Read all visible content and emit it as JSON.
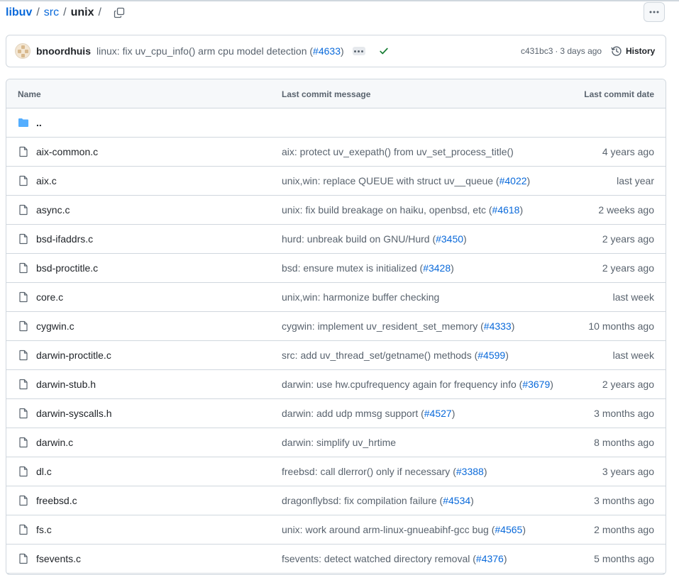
{
  "breadcrumb": {
    "repo": "libuv",
    "sep1": "/",
    "dir": "src",
    "sep2": "/",
    "current": "unix",
    "sep3": "/"
  },
  "commit": {
    "author": "bnoordhuis",
    "message": "linux: fix uv_cpu_info() arm cpu model detection (",
    "pr": "#4633",
    "message_end": ")",
    "hash": "c431bc3",
    "separator": "·",
    "age": "3 days ago",
    "history_label": "History",
    "status": "success",
    "success_color": "#1a7f37"
  },
  "table": {
    "headers": {
      "name": "Name",
      "message": "Last commit message",
      "date": "Last commit date"
    },
    "parent_label": "..",
    "rows": [
      {
        "name": "aix-common.c",
        "msg": "aix: protect uv_exepath() from uv_set_process_title()",
        "pr": "",
        "end": "",
        "date": "4 years ago"
      },
      {
        "name": "aix.c",
        "msg": "unix,win: replace QUEUE with struct uv__queue (",
        "pr": "#4022",
        "end": ")",
        "date": "last year"
      },
      {
        "name": "async.c",
        "msg": "unix: fix build breakage on haiku, openbsd, etc (",
        "pr": "#4618",
        "end": ")",
        "date": "2 weeks ago"
      },
      {
        "name": "bsd-ifaddrs.c",
        "msg": "hurd: unbreak build on GNU/Hurd (",
        "pr": "#3450",
        "end": ")",
        "date": "2 years ago"
      },
      {
        "name": "bsd-proctitle.c",
        "msg": "bsd: ensure mutex is initialized (",
        "pr": "#3428",
        "end": ")",
        "date": "2 years ago"
      },
      {
        "name": "core.c",
        "msg": "unix,win: harmonize buffer checking",
        "pr": "",
        "end": "",
        "date": "last week"
      },
      {
        "name": "cygwin.c",
        "msg": "cygwin: implement uv_resident_set_memory (",
        "pr": "#4333",
        "end": ")",
        "date": "10 months ago"
      },
      {
        "name": "darwin-proctitle.c",
        "msg": "src: add uv_thread_set/getname() methods (",
        "pr": "#4599",
        "end": ")",
        "date": "last week"
      },
      {
        "name": "darwin-stub.h",
        "msg": "darwin: use hw.cpufrequency again for frequency info (",
        "pr": "#3679",
        "end": ")",
        "date": "2 years ago"
      },
      {
        "name": "darwin-syscalls.h",
        "msg": "darwin: add udp mmsg support (",
        "pr": "#4527",
        "end": ")",
        "date": "3 months ago"
      },
      {
        "name": "darwin.c",
        "msg": "darwin: simplify uv_hrtime",
        "pr": "",
        "end": "",
        "date": "8 months ago"
      },
      {
        "name": "dl.c",
        "msg": "freebsd: call dlerror() only if necessary (",
        "pr": "#3388",
        "end": ")",
        "date": "3 years ago"
      },
      {
        "name": "freebsd.c",
        "msg": "dragonflybsd: fix compilation failure (",
        "pr": "#4534",
        "end": ")",
        "date": "3 months ago"
      },
      {
        "name": "fs.c",
        "msg": "unix: work around arm-linux-gnueabihf-gcc bug (",
        "pr": "#4565",
        "end": ")",
        "date": "2 months ago"
      },
      {
        "name": "fsevents.c",
        "msg": "fsevents: detect watched directory removal (",
        "pr": "#4376",
        "end": ")",
        "date": "5 months ago"
      }
    ]
  },
  "colors": {
    "link": "#0969da",
    "folder": "#54aeff",
    "muted": "#59636e",
    "border": "#d0d7de"
  }
}
